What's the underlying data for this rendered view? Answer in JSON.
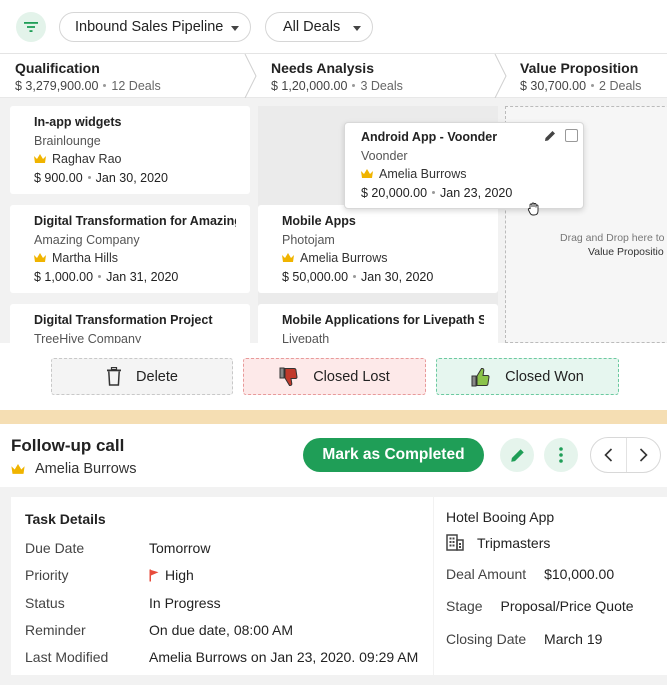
{
  "toolbar": {
    "pipeline_select": "Inbound Sales Pipeline",
    "deals_select": "All Deals"
  },
  "stages": [
    {
      "name": "Qualification",
      "amount": "$ 3,279,900.00",
      "count": "12 Deals"
    },
    {
      "name": "Needs Analysis",
      "amount": "$ 1,20,000.00",
      "count": "3 Deals"
    },
    {
      "name": "Value Proposition",
      "amount": "$ 30,700.00",
      "count": "2 Deals"
    }
  ],
  "board": {
    "col1": [
      {
        "title": "In-app widgets",
        "company": "Brainlounge",
        "owner": "Raghav Rao",
        "amount": "$ 900.00",
        "date": "Jan 30, 2020"
      },
      {
        "title": "Digital Transformation for Amazing...",
        "company": "Amazing Company",
        "owner": "Martha Hills",
        "amount": "$ 1,000.00",
        "date": "Jan 31, 2020"
      },
      {
        "title": "Digital Transformation Project",
        "company": "TreeHive Company"
      }
    ],
    "col2": [
      {
        "title": "Mobile Apps",
        "company": "Photojam",
        "owner": "Amelia Burrows",
        "amount": "$ 50,000.00",
        "date": "Jan 30, 2020"
      },
      {
        "title": "Mobile Applications for Livepath Serv...",
        "company": "Livepath"
      }
    ],
    "dragging": {
      "title": "Android App - Voonder",
      "company": "Voonder",
      "owner": "Amelia Burrows",
      "amount": "$ 20,000.00",
      "date": "Jan 23, 2020"
    },
    "drop_hint_line1": "Drag and Drop here to m",
    "drop_hint_line2": "Value Propositio"
  },
  "actions": {
    "delete": "Delete",
    "closed_lost": "Closed Lost",
    "closed_won": "Closed Won"
  },
  "task": {
    "title": "Follow-up call",
    "owner": "Amelia Burrows",
    "complete_label": "Mark as Completed",
    "details_heading": "Task Details",
    "rows": [
      {
        "label": "Due Date",
        "value": "Tomorrow"
      },
      {
        "label": "Priority",
        "value": "High"
      },
      {
        "label": "Status",
        "value": "In Progress"
      },
      {
        "label": "Reminder",
        "value": "On due date, 08:00 AM"
      },
      {
        "label": "Last Modified",
        "value": "Amelia Burrows on Jan 23, 2020. 09:29 AM"
      }
    ],
    "related": {
      "deal_name": "Hotel Booing App",
      "account": "Tripmasters",
      "amount_label": "Deal Amount",
      "amount_value": "$10,000.00",
      "stage_label": "Stage",
      "stage_value": "Proposal/Price Quote",
      "closing_label": "Closing Date",
      "closing_value": "March 19"
    }
  },
  "colors": {
    "brand_green": "#1f9e57",
    "crown": "#f0b400",
    "priority_flag": "#e74c3c"
  },
  "icons": [
    "filter-icon",
    "crown-icon",
    "pencil-icon",
    "checkbox-icon",
    "grab-cursor-icon",
    "trash-icon",
    "thumbs-down-icon",
    "thumbs-up-icon",
    "more-vertical-icon",
    "chevron-left-icon",
    "chevron-right-icon",
    "flag-icon",
    "building-icon"
  ]
}
